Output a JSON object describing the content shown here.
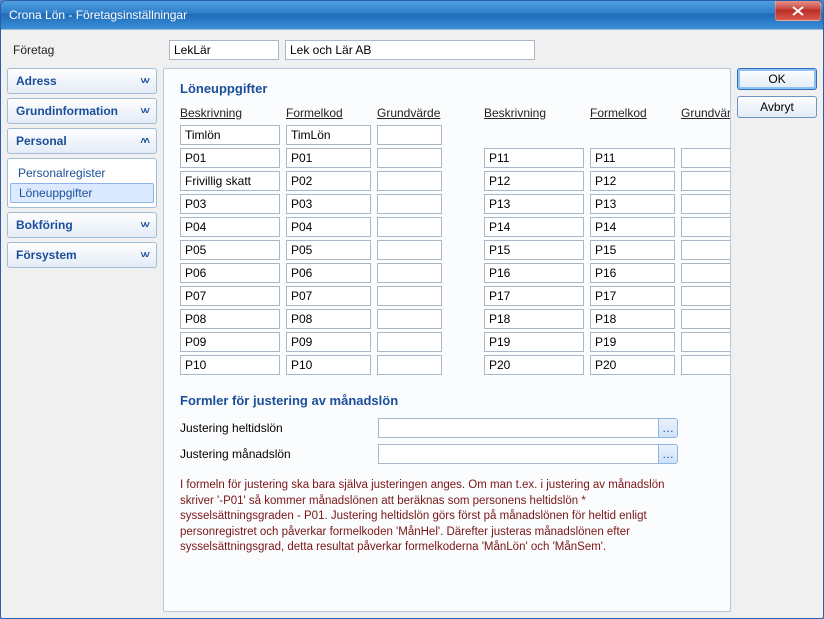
{
  "window_title": "Crona Lön - Företagsinställningar",
  "company": {
    "label": "Företag",
    "code": "LekLär",
    "name": "Lek och Lär AB"
  },
  "sidebar": {
    "items": [
      {
        "label": "Adress",
        "expanded": false
      },
      {
        "label": "Grundinformation",
        "expanded": false
      },
      {
        "label": "Personal",
        "expanded": true,
        "children": [
          {
            "label": "Personalregister",
            "selected": false
          },
          {
            "label": "Löneuppgifter",
            "selected": true
          }
        ]
      },
      {
        "label": "Bokföring",
        "expanded": false
      },
      {
        "label": "Försystem",
        "expanded": false
      }
    ]
  },
  "buttons": {
    "ok": "OK",
    "cancel": "Avbryt"
  },
  "main": {
    "title": "Löneuppgifter",
    "headers": {
      "desc": "Beskrivning",
      "code": "Formelkod",
      "base": "Grundvärde"
    },
    "rows_left": [
      {
        "desc": "Timlön",
        "code": "TimLön",
        "base": ""
      },
      {
        "desc": "P01",
        "code": "P01",
        "base": ""
      },
      {
        "desc": "Frivillig skatt",
        "code": "P02",
        "base": ""
      },
      {
        "desc": "P03",
        "code": "P03",
        "base": ""
      },
      {
        "desc": "P04",
        "code": "P04",
        "base": ""
      },
      {
        "desc": "P05",
        "code": "P05",
        "base": ""
      },
      {
        "desc": "P06",
        "code": "P06",
        "base": ""
      },
      {
        "desc": "P07",
        "code": "P07",
        "base": ""
      },
      {
        "desc": "P08",
        "code": "P08",
        "base": ""
      },
      {
        "desc": "P09",
        "code": "P09",
        "base": ""
      },
      {
        "desc": "P10",
        "code": "P10",
        "base": ""
      }
    ],
    "rows_right": [
      {
        "desc": "",
        "code": "",
        "base": ""
      },
      {
        "desc": "P11",
        "code": "P11",
        "base": ""
      },
      {
        "desc": "P12",
        "code": "P12",
        "base": ""
      },
      {
        "desc": "P13",
        "code": "P13",
        "base": ""
      },
      {
        "desc": "P14",
        "code": "P14",
        "base": ""
      },
      {
        "desc": "P15",
        "code": "P15",
        "base": ""
      },
      {
        "desc": "P16",
        "code": "P16",
        "base": ""
      },
      {
        "desc": "P17",
        "code": "P17",
        "base": ""
      },
      {
        "desc": "P18",
        "code": "P18",
        "base": ""
      },
      {
        "desc": "P19",
        "code": "P19",
        "base": ""
      },
      {
        "desc": "P20",
        "code": "P20",
        "base": ""
      }
    ],
    "formula_section_title": "Formler för justering av månadslön",
    "fulltime_label": "Justering heltidslön",
    "fulltime_value": "",
    "monthly_label": "Justering månadslön",
    "monthly_value": "",
    "help_text": "I formeln för justering ska bara själva justeringen anges. Om man t.ex.  i justering av månadslön skriver '-P01' så kommer månadslönen att beräknas som personens heltidslön * sysselsättningsgraden - P01. Justering heltidslön görs först på månadslönen för heltid enligt personregistret och påverkar formelkoden 'MånHel'. Därefter justeras månadslönen efter sysselsättningsgrad, detta resultat påverkar formelkoderna 'MånLön' och 'MånSem'."
  }
}
